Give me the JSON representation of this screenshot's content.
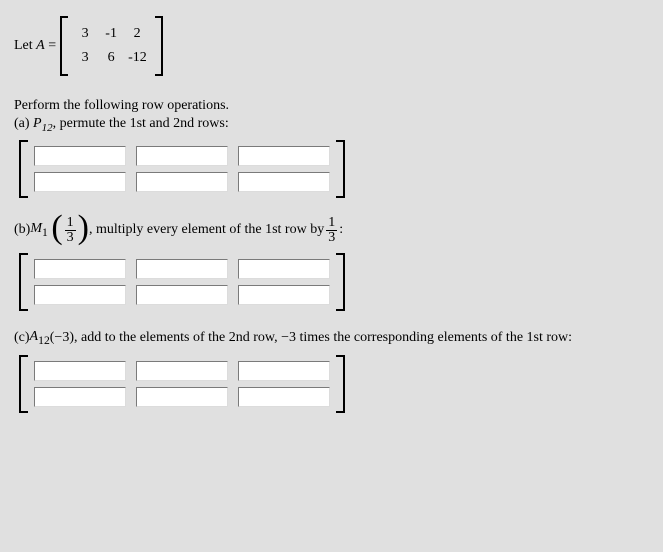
{
  "intro": {
    "let_prefix": "Let ",
    "A_symbol": "A",
    "equals": " = "
  },
  "matrix_A": {
    "rows": [
      [
        "3",
        "-1",
        "2"
      ],
      [
        "3",
        "6",
        "-12"
      ]
    ]
  },
  "directions": "Perform the following row operations.",
  "part_a": {
    "label": "(a) ",
    "op": "P",
    "op_sub": "12",
    "rest": ", permute the 1st and 2nd rows:"
  },
  "part_b": {
    "label": "(b) ",
    "op": "M",
    "op_sub": "1",
    "frac_num": "1",
    "frac_den": "3",
    "mid": ", multiply every element of the 1st row by ",
    "tail": ":"
  },
  "part_c": {
    "label": "(c) ",
    "op": "A",
    "op_sub": "12",
    "arg": "(−3)",
    "rest": ", add to the elements of the 2nd row, −3 times the corresponding elements of the 1st row:"
  }
}
